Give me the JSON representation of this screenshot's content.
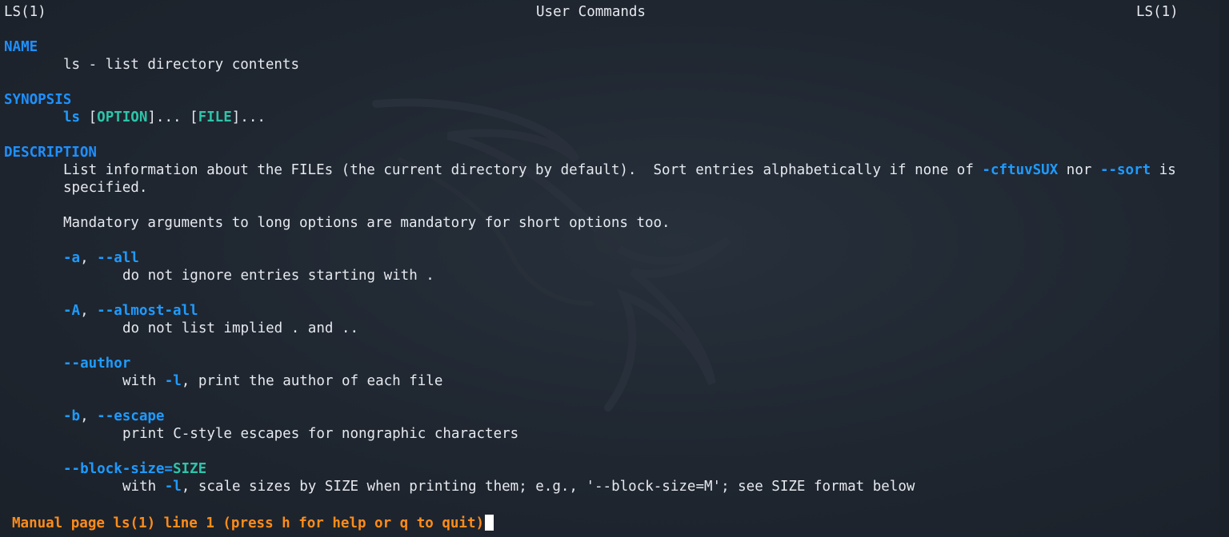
{
  "header": {
    "left": "LS(1)",
    "center": "User Commands",
    "right": "LS(1)"
  },
  "name": {
    "heading": "NAME",
    "text": "ls - list directory contents"
  },
  "synopsis": {
    "heading": "SYNOPSIS",
    "cmd": "ls",
    "b1": " [",
    "option": "OPTION",
    "b2": "]... [",
    "file": "FILE",
    "b3": "]..."
  },
  "description": {
    "heading": "DESCRIPTION",
    "p1_a": "List information about the FILEs (the current directory by default).  Sort entries alphabetically if none of ",
    "p1_opt1": "-cftuvSUX",
    "p1_b": " nor ",
    "p1_opt2": "--sort",
    "p1_c": " is",
    "p1_line2": "specified.",
    "p2": "Mandatory arguments to long options are mandatory for short options too."
  },
  "options": [
    {
      "short": "-a",
      "sep": ", ",
      "long": "--all",
      "desc": "do not ignore entries starting with ."
    },
    {
      "short": "-A",
      "sep": ", ",
      "long": "--almost-all",
      "desc": "do not list implied . and .."
    },
    {
      "long": "--author",
      "desc_a": "with ",
      "desc_opt": "-l",
      "desc_b": ", print the author of each file"
    },
    {
      "short": "-b",
      "sep": ", ",
      "long": "--escape",
      "desc": "print C-style escapes for nongraphic characters"
    },
    {
      "long": "--block-size=",
      "arg": "SIZE",
      "desc_a": "with ",
      "desc_opt": "-l",
      "desc_b": ", scale sizes by SIZE when printing them; e.g., '--block-size=M'; see SIZE format below"
    }
  ],
  "status": {
    "text": "Manual page ls(1) line 1 (press h for help or q to quit)"
  },
  "colors": {
    "background": "#1f2630",
    "section": "#1e90ff",
    "option": "#1e9bff",
    "argument": "#2ec4a9",
    "status": "#ff8c1a",
    "text": "#e6e9ee"
  }
}
